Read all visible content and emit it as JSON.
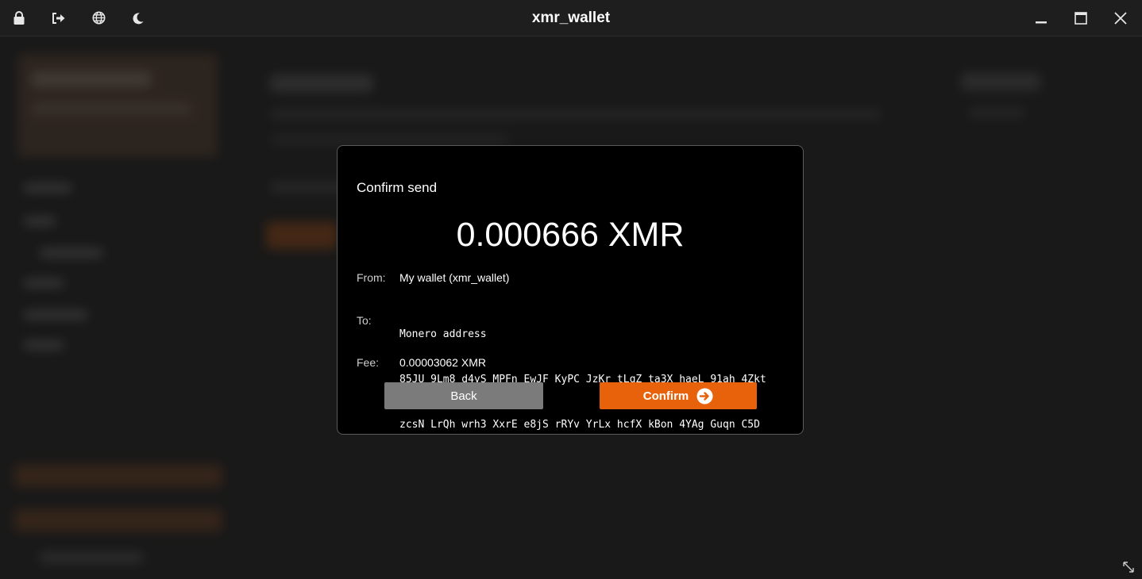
{
  "window": {
    "title": "xmr_wallet",
    "left_icons": [
      "lock-icon",
      "logout-icon",
      "globe-icon",
      "moon-icon"
    ],
    "right_controls": [
      "minimize-icon",
      "maximize-icon",
      "close-icon"
    ]
  },
  "dialog": {
    "title": "Confirm send",
    "amount": "0.000666 XMR",
    "from_label": "From:",
    "from_value": "My wallet (xmr_wallet)",
    "to_label": "To:",
    "to_address_type": "Monero address",
    "to_address_line1": "85JU 9Lm8 d4yS MPFn EwJF KyPC JzKr tLqZ ta3X haeL 91ah 4Zkt",
    "to_address_line2": "zcsN LrQh wrh3 XxrE e8jS rRYv YrLx hcfX kBon 4YAg Guqn C5D",
    "fee_label": "Fee:",
    "fee_value": "0.00003062 XMR",
    "back_label": "Back",
    "confirm_label": "Confirm"
  },
  "colors": {
    "accent": "#e8620b",
    "back_button": "#7b7b7b",
    "dialog_bg": "#000000"
  }
}
